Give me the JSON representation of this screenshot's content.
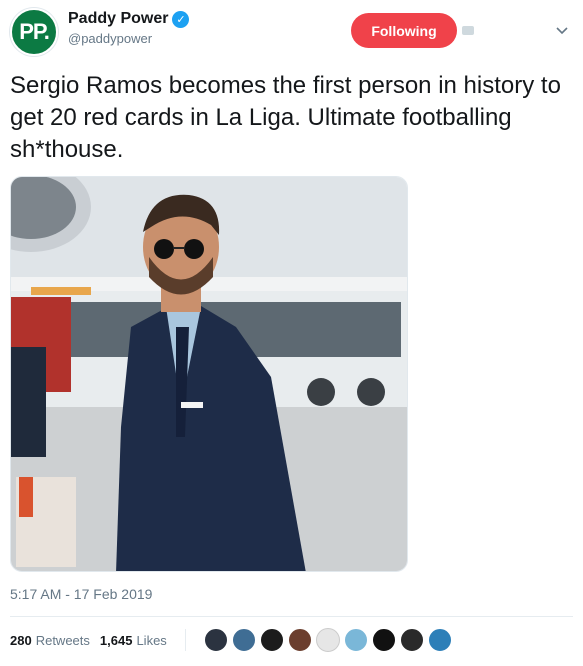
{
  "tweet": {
    "author": {
      "name": "Paddy Power",
      "handle": "@paddypower",
      "avatar_text": "PP."
    },
    "follow_label": "Following",
    "text": "Sergio Ramos becomes the first person in history to get 20 red cards in La Liga. Ultimate footballing sh*thouse.",
    "timestamp": "5:17 AM - 17 Feb 2019",
    "stats": {
      "retweets_count": "280",
      "retweets_label": "Retweets",
      "likes_count": "1,645",
      "likes_label": "Likes"
    },
    "liker_avatars": [
      "avatar-1",
      "avatar-2",
      "avatar-3",
      "avatar-4",
      "avatar-5",
      "avatar-6",
      "avatar-7",
      "avatar-8",
      "avatar-9"
    ]
  },
  "icons": {
    "verified": "verified-icon",
    "more": "chevron-down-icon"
  },
  "colors": {
    "follow_bg": "#f0424a",
    "brand": "#0c7a43",
    "verified": "#1da1f2"
  }
}
